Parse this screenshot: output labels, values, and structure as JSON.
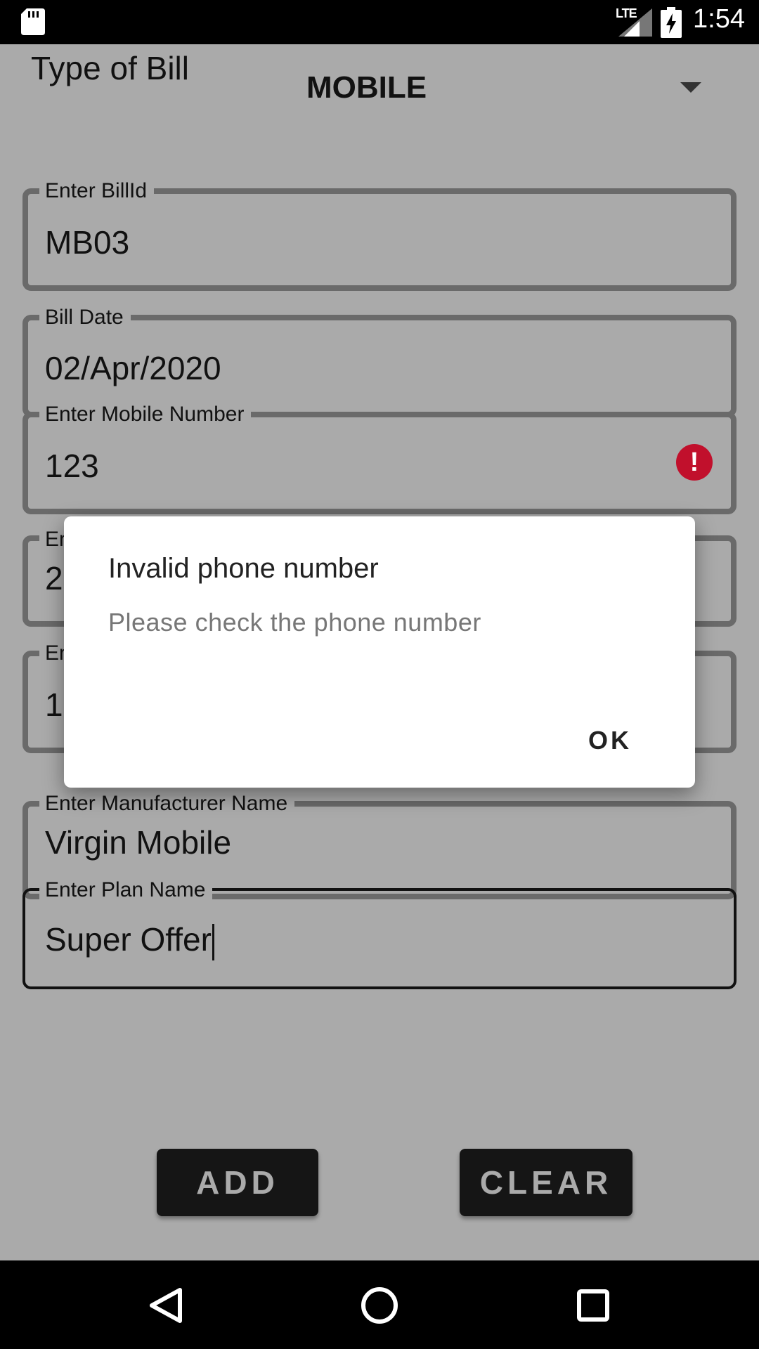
{
  "status_bar": {
    "network": "LTE",
    "time": "1:54",
    "icons": [
      "sd-card-icon",
      "signal-icon",
      "battery-charging-icon"
    ]
  },
  "form": {
    "type_label": "Type of Bill",
    "type_value": "MOBILE",
    "fields": {
      "bill_id": {
        "label": "Enter BillId",
        "value": "MB03"
      },
      "bill_date": {
        "label": "Bill Date",
        "value": "02/Apr/2020"
      },
      "mobile_number": {
        "label": "Enter Mobile Number",
        "value": "123"
      },
      "field4": {
        "label_partial": "En",
        "value_partial": "2"
      },
      "field5": {
        "label_partial": "En",
        "value_partial": "1"
      },
      "manufacturer": {
        "label": "Enter Manufacturer Name",
        "value": "Virgin Mobile"
      },
      "plan_name": {
        "label": "Enter Plan Name",
        "value": "Super Offer"
      }
    },
    "error_icon": "error-icon",
    "add_label": "ADD",
    "clear_label": "CLEAR"
  },
  "dialog": {
    "title": "Invalid phone number",
    "message": "Please check the phone number",
    "ok_label": "OK"
  },
  "colors": {
    "scrim_background": "#aaaaaa",
    "error": "#c1102c",
    "button_bg": "#151515"
  },
  "nav_icons": [
    "back-icon",
    "home-icon",
    "recents-icon"
  ]
}
